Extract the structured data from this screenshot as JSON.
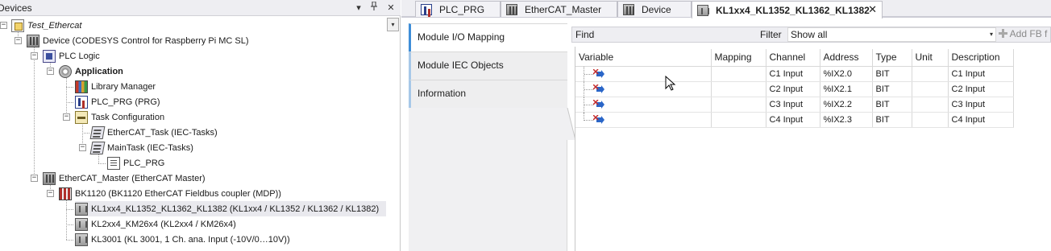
{
  "devices_pane": {
    "title": "Devices",
    "buttons": {
      "dropdown": "▾",
      "pin": "📌",
      "close": "✕"
    },
    "combo_arrow": "▾",
    "tree": [
      {
        "label": "Test_Ethercat",
        "icon": "project-icon",
        "style": "italic"
      },
      {
        "label": "Device (CODESYS Control for Raspberry Pi MC SL)",
        "icon": "device-icon"
      },
      {
        "label": "PLC Logic",
        "icon": "plc-logic-icon"
      },
      {
        "label": "Application",
        "icon": "application-icon",
        "style": "bold"
      },
      {
        "label": "Library Manager",
        "icon": "library-manager-icon"
      },
      {
        "label": "PLC_PRG (PRG)",
        "icon": "pou-icon"
      },
      {
        "label": "Task Configuration",
        "icon": "task-configuration-icon"
      },
      {
        "label": "EtherCAT_Task (IEC-Tasks)",
        "icon": "task-icon"
      },
      {
        "label": "MainTask (IEC-Tasks)",
        "icon": "task-icon"
      },
      {
        "label": "PLC_PRG",
        "icon": "program-call-icon"
      },
      {
        "label": "EtherCAT_Master (EtherCAT Master)",
        "icon": "ethercat-master-icon"
      },
      {
        "label": "BK1120 (BK1120 EtherCAT Fieldbus coupler (MDP))",
        "icon": "coupler-icon"
      },
      {
        "label": "KL1xx4_KL1352_KL1362_KL1382 (KL1xx4 / KL1352 / KL1362 / KL1382)",
        "icon": "io-module-icon",
        "selected": true
      },
      {
        "label": "KL2xx4_KM26x4 (KL2xx4 / KM26x4)",
        "icon": "io-module-icon"
      },
      {
        "label": "KL3001 (KL 3001, 1 Ch. ana. Input (-10V/0…10V))",
        "icon": "io-module-icon"
      }
    ]
  },
  "editor": {
    "tabs": [
      {
        "label": "PLC_PRG",
        "icon": "pou-icon"
      },
      {
        "label": "EtherCAT_Master",
        "icon": "device-icon"
      },
      {
        "label": "Device",
        "icon": "device-icon"
      },
      {
        "label": "KL1xx4_KL1352_KL1362_KL1382",
        "icon": "io-module-icon",
        "active": true,
        "close": "✕"
      }
    ],
    "side_tabs": [
      {
        "label": "Module I/O Mapping",
        "active": true
      },
      {
        "label": "Module IEC Objects"
      },
      {
        "label": "Information"
      }
    ],
    "find_bar": {
      "find_label": "Find",
      "find_value": "",
      "filter_label": "Filter",
      "filter_value": "Show all",
      "filter_arrow": "▾",
      "add_fb_label": "Add FB f"
    },
    "mapping_table": {
      "columns": [
        "Variable",
        "Mapping",
        "Channel",
        "Address",
        "Type",
        "Unit",
        "Description"
      ],
      "rows": [
        {
          "variable": "",
          "mapping": "",
          "channel": "C1 Input",
          "address": "%IX2.0",
          "type": "BIT",
          "unit": "",
          "description": "C1 Input"
        },
        {
          "variable": "",
          "mapping": "",
          "channel": "C2 Input",
          "address": "%IX2.1",
          "type": "BIT",
          "unit": "",
          "description": "C2 Input"
        },
        {
          "variable": "",
          "mapping": "",
          "channel": "C3 Input",
          "address": "%IX2.2",
          "type": "BIT",
          "unit": "",
          "description": "C3 Input"
        },
        {
          "variable": "",
          "mapping": "",
          "channel": "C4 Input",
          "address": "%IX2.3",
          "type": "BIT",
          "unit": "",
          "description": "C4 Input"
        }
      ]
    }
  },
  "colors": {
    "accent_tab": "#3e8ed8",
    "inactive_tab_marker": "#a7c8e8",
    "selected_row": "#e9e9ee"
  }
}
